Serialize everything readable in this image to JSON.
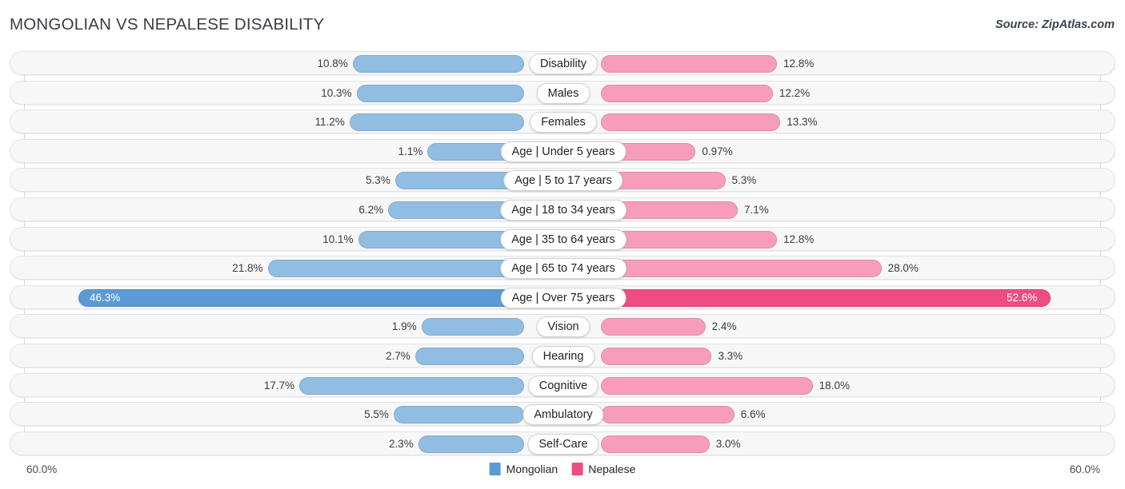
{
  "header": {
    "title": "MONGOLIAN VS NEPALESE DISABILITY",
    "source": "Source: ZipAtlas.com"
  },
  "legend": {
    "left_label": "Mongolian",
    "right_label": "Nepalese",
    "left_color": "#5b9bd5",
    "right_color": "#ef4c84"
  },
  "axis": {
    "left_max_label": "60.0%",
    "right_max_label": "60.0%",
    "max": 60.0
  },
  "colors": {
    "bar_left_light": "#92bde3",
    "bar_left_dark": "#5b9bd5",
    "bar_right_light": "#f79dbb",
    "bar_right_dark": "#ef4c84",
    "row_bg": "#f7f7f7",
    "row_border": "#e3e3e3"
  },
  "chart_data": {
    "type": "bar",
    "orientation": "horizontal-diverging",
    "title": "MONGOLIAN VS NEPALESE DISABILITY",
    "xlabel": "",
    "ylabel": "",
    "xlim": [
      0,
      60
    ],
    "grid": true,
    "legend_position": "bottom-center",
    "categories": [
      "Disability",
      "Males",
      "Females",
      "Age | Under 5 years",
      "Age | 5 to 17 years",
      "Age | 18 to 34 years",
      "Age | 35 to 64 years",
      "Age | 65 to 74 years",
      "Age | Over 75 years",
      "Vision",
      "Hearing",
      "Cognitive",
      "Ambulatory",
      "Self-Care"
    ],
    "series": [
      {
        "name": "Mongolian",
        "values": [
          10.8,
          10.3,
          11.2,
          1.1,
          5.3,
          6.2,
          10.1,
          21.8,
          46.3,
          1.9,
          2.7,
          17.7,
          5.5,
          2.3
        ],
        "labels": [
          "10.8%",
          "10.3%",
          "11.2%",
          "1.1%",
          "5.3%",
          "6.2%",
          "10.1%",
          "21.8%",
          "46.3%",
          "1.9%",
          "2.7%",
          "17.7%",
          "5.5%",
          "2.3%"
        ]
      },
      {
        "name": "Nepalese",
        "values": [
          12.8,
          12.2,
          13.3,
          0.97,
          5.3,
          7.1,
          12.8,
          28.0,
          52.6,
          2.4,
          3.3,
          18.0,
          6.6,
          3.0
        ],
        "labels": [
          "12.8%",
          "12.2%",
          "13.3%",
          "0.97%",
          "5.3%",
          "7.1%",
          "12.8%",
          "28.0%",
          "52.6%",
          "2.4%",
          "3.3%",
          "18.0%",
          "6.6%",
          "3.0%"
        ]
      }
    ]
  }
}
